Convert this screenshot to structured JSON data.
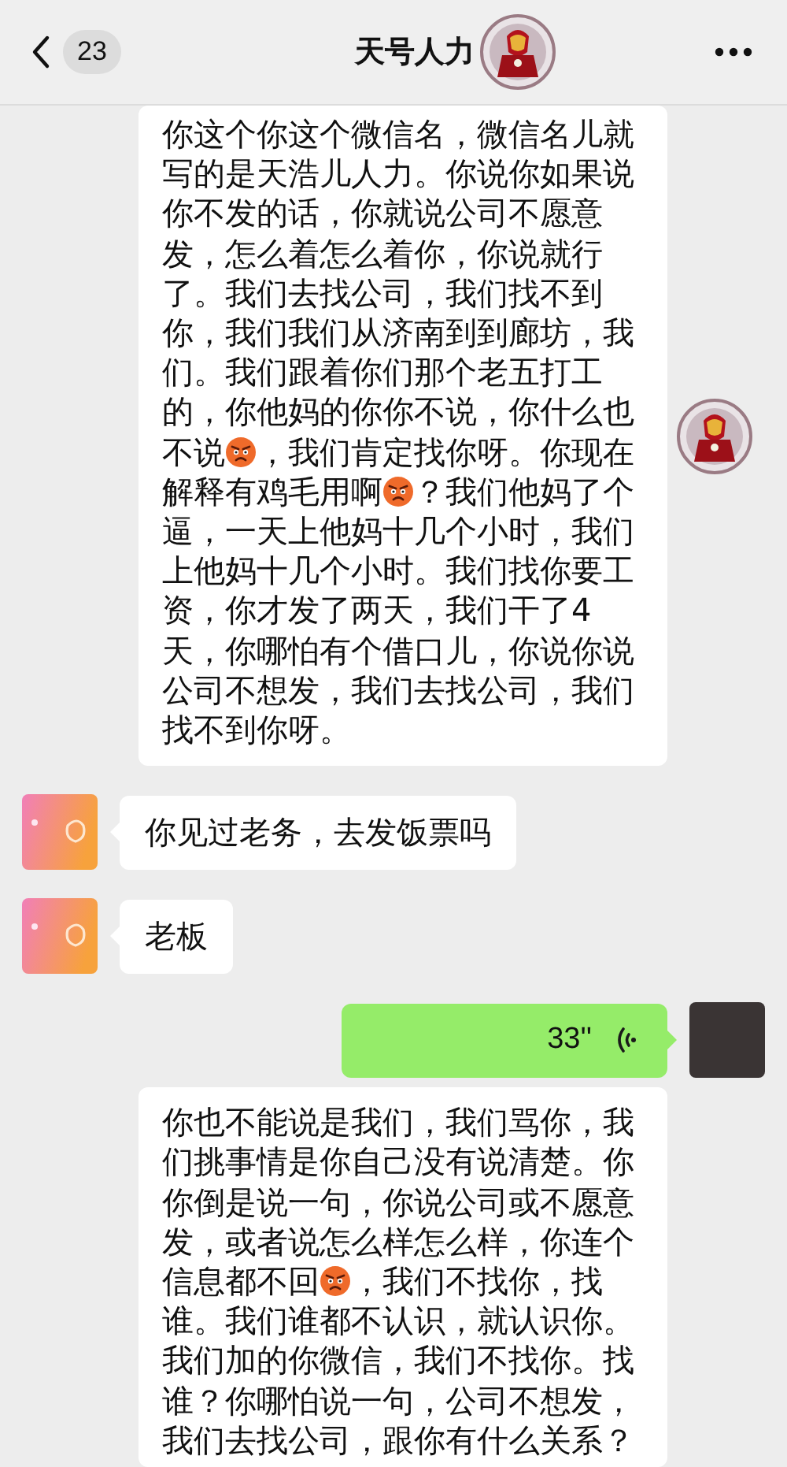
{
  "header": {
    "back_count": "23",
    "title": "天号人力"
  },
  "messages": [
    {
      "kind": "transcript",
      "outgoing": true,
      "avatar": {
        "kind": "cartoon"
      },
      "parts": [
        {
          "kind": "text",
          "text": "你这个你这个微信名，微信名儿就写的是天浩儿人力。你说你如果说你不发的话，你就说公司不愿意发，怎么着怎么着你，你说就行了。我们去找公司，我们找不到你，我们我们从济南到到廊坊，我们。我们跟着你们那个老五打工的，你他妈的你你不说，你什么也不说"
        },
        {
          "kind": "emoji"
        },
        {
          "kind": "text",
          "text": "，我们肯定找你呀。你现在解释有鸡毛用啊"
        },
        {
          "kind": "emoji"
        },
        {
          "kind": "text",
          "text": "？我们他妈了个逼，一天上他妈十几个小时，我们上他妈十几个小时。我们找你要工资，你才发了两天，我们干了4天，你哪怕有个借口儿，你说你说公司不想发，我们去找公司，我们找不到你呀。"
        }
      ]
    },
    {
      "kind": "text",
      "outgoing": false,
      "avatar": {
        "kind": "gradient"
      },
      "text": "你见过老务，去发饭票吗"
    },
    {
      "kind": "text",
      "outgoing": false,
      "avatar": {
        "kind": "gradient"
      },
      "text": "老板"
    },
    {
      "kind": "voice",
      "outgoing": true,
      "avatar": {
        "kind": "photo"
      },
      "duration": "33''"
    },
    {
      "kind": "transcript",
      "outgoing": true,
      "parts": [
        {
          "kind": "text",
          "text": "你也不能说是我们，我们骂你，我们挑事情是你自己没有说清楚。你你倒是说一句，你说公司或不愿意发，或者说怎么样怎么样，你连个信息都不回"
        },
        {
          "kind": "emoji"
        },
        {
          "kind": "text",
          "text": "，我们不找你，找谁。我们谁都不认识，就认识你。我们加的你微信，我们不找你。找谁？你哪怕说一句，公司不想发，我们去找公司，跟你有什么关系？"
        }
      ]
    }
  ]
}
